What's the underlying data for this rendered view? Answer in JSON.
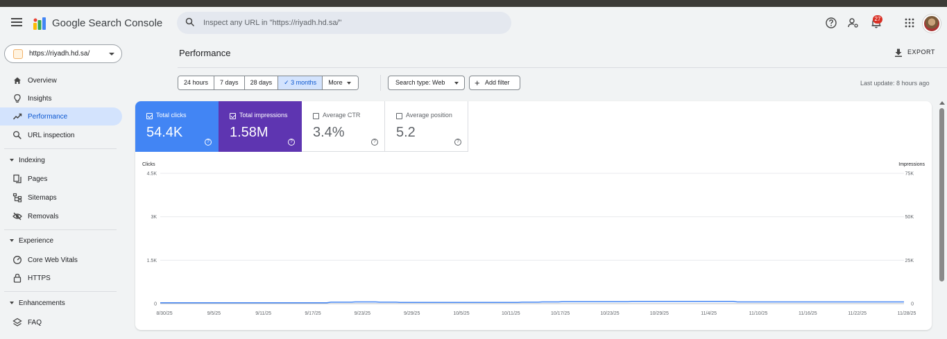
{
  "app": {
    "name": "Google Search Console",
    "search_placeholder": "Inspect any URL in \"https://riyadh.hd.sa/\"",
    "notification_count": "27",
    "colors": {
      "clicks": "#4285f4",
      "impressions": "#5e35b1",
      "active_nav_bg": "#d3e3fd"
    }
  },
  "header": {
    "icons": [
      "menu-icon",
      "help-icon",
      "manage-users-icon",
      "notifications-icon",
      "apps-icon",
      "avatar"
    ]
  },
  "property": {
    "label": "https://riyadh.hd.sa/"
  },
  "sidebar": {
    "items": [
      {
        "label": "Overview",
        "icon": "home-icon"
      },
      {
        "label": "Insights",
        "icon": "lightbulb-icon"
      },
      {
        "label": "Performance",
        "icon": "trending-icon",
        "active": true
      },
      {
        "label": "URL inspection",
        "icon": "search-icon"
      }
    ],
    "sections": [
      {
        "label": "Indexing",
        "items": [
          {
            "label": "Pages",
            "icon": "pages-icon"
          },
          {
            "label": "Sitemaps",
            "icon": "sitemap-icon"
          },
          {
            "label": "Removals",
            "icon": "eye-off-icon"
          }
        ]
      },
      {
        "label": "Experience",
        "items": [
          {
            "label": "Core Web Vitals",
            "icon": "gauge-icon"
          },
          {
            "label": "HTTPS",
            "icon": "lock-icon"
          }
        ]
      },
      {
        "label": "Enhancements",
        "items": [
          {
            "label": "FAQ",
            "icon": "layers-icon"
          }
        ]
      }
    ]
  },
  "main": {
    "title": "Performance",
    "export_label": "EXPORT",
    "date_ranges": [
      "24 hours",
      "7 days",
      "28 days",
      "3 months",
      "More"
    ],
    "selected_range": "3 months",
    "filters": {
      "search_type": "Search type: Web",
      "add_filter": "Add filter"
    },
    "last_update": "Last update: 8 hours ago",
    "metrics": [
      {
        "label": "Total clicks",
        "value": "54.4K",
        "checked": true
      },
      {
        "label": "Total impressions",
        "value": "1.58M",
        "checked": true
      },
      {
        "label": "Average CTR",
        "value": "3.4%",
        "checked": false
      },
      {
        "label": "Average position",
        "value": "5.2",
        "checked": false
      }
    ]
  },
  "chart_data": {
    "type": "line",
    "left_axis_title": "Clicks",
    "right_axis_title": "Impressions",
    "left_ticks": [
      "0",
      "1.5K",
      "3K",
      "4.5K"
    ],
    "right_ticks": [
      "0",
      "25K",
      "50K",
      "75K"
    ],
    "ylim_left": [
      0,
      4500
    ],
    "ylim_right": [
      0,
      75000
    ],
    "x_tick_labels": [
      "8/30/25",
      "9/5/25",
      "9/11/25",
      "9/17/25",
      "9/23/25",
      "9/29/25",
      "10/5/25",
      "10/11/25",
      "10/17/25",
      "10/23/25",
      "10/29/25",
      "11/4/25",
      "11/10/25",
      "11/16/25",
      "11/22/25",
      "11/28/25"
    ],
    "grid": true,
    "series": [
      {
        "name": "Clicks",
        "axis": "left",
        "color": "#4285f4",
        "values": [
          30,
          30,
          30,
          30,
          30,
          30,
          30,
          30,
          30,
          30,
          30,
          30,
          30,
          30,
          30,
          30,
          30,
          30,
          30,
          30,
          30,
          30,
          30,
          30,
          30,
          30,
          30,
          30,
          30,
          30,
          30,
          30,
          30,
          30,
          30,
          30,
          30,
          30,
          30,
          30,
          30,
          30,
          50,
          50,
          50,
          50,
          50,
          50,
          60,
          60,
          60,
          60,
          60,
          60,
          50,
          50,
          50,
          50,
          50,
          40,
          40,
          40,
          40,
          40,
          40,
          40,
          40,
          40,
          40,
          40,
          40,
          40,
          40,
          40,
          40,
          40,
          40,
          40,
          40,
          40,
          40,
          40,
          40,
          40,
          40,
          40,
          40,
          40,
          40,
          50,
          50,
          50,
          50,
          50,
          60,
          60,
          60,
          60,
          60,
          70,
          70,
          70,
          70,
          70,
          70,
          70,
          70,
          70,
          70,
          70,
          70,
          70,
          70,
          70,
          70,
          70,
          80,
          80,
          80,
          80,
          80,
          80,
          80,
          80,
          80,
          80,
          80,
          80,
          80,
          80,
          80,
          80,
          80,
          80,
          80,
          80,
          80,
          80,
          80,
          80,
          80,
          80,
          60,
          60,
          60,
          60,
          60,
          60,
          60,
          60,
          60,
          60,
          60,
          60,
          60,
          60,
          60,
          60,
          60,
          60,
          60,
          60,
          60,
          60,
          60,
          60,
          60,
          60,
          60,
          60,
          60,
          60,
          60,
          60,
          60,
          60,
          60,
          60,
          60,
          60,
          60,
          60,
          60,
          60
        ]
      }
    ]
  }
}
